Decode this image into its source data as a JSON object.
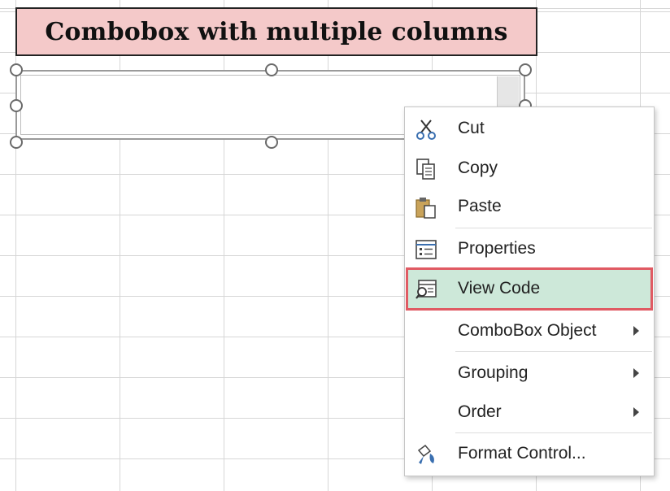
{
  "title": "Combobox with multiple columns",
  "combobox": {
    "handles": [
      "top-left",
      "top-center",
      "top-right",
      "middle-left",
      "middle-right",
      "bottom-left",
      "bottom-center"
    ]
  },
  "context_menu": {
    "items": [
      {
        "label": "Cut",
        "icon": "scissors-icon"
      },
      {
        "label": "Copy",
        "icon": "copy-icon"
      },
      {
        "label": "Paste",
        "icon": "paste-icon"
      },
      {
        "label": "Properties",
        "icon": "properties-icon"
      },
      {
        "label": "View Code",
        "icon": "view-code-icon",
        "highlighted": true
      },
      {
        "label": "ComboBox Object",
        "has_submenu": true
      },
      {
        "label": "Grouping",
        "has_submenu": true
      },
      {
        "label": "Order",
        "has_submenu": true
      },
      {
        "label": "Format Control...",
        "icon": "format-control-icon"
      }
    ]
  },
  "colors": {
    "title_background": "#f4c9c9",
    "highlight_background": "#cde8d9",
    "highlight_border": "#e05a63"
  }
}
